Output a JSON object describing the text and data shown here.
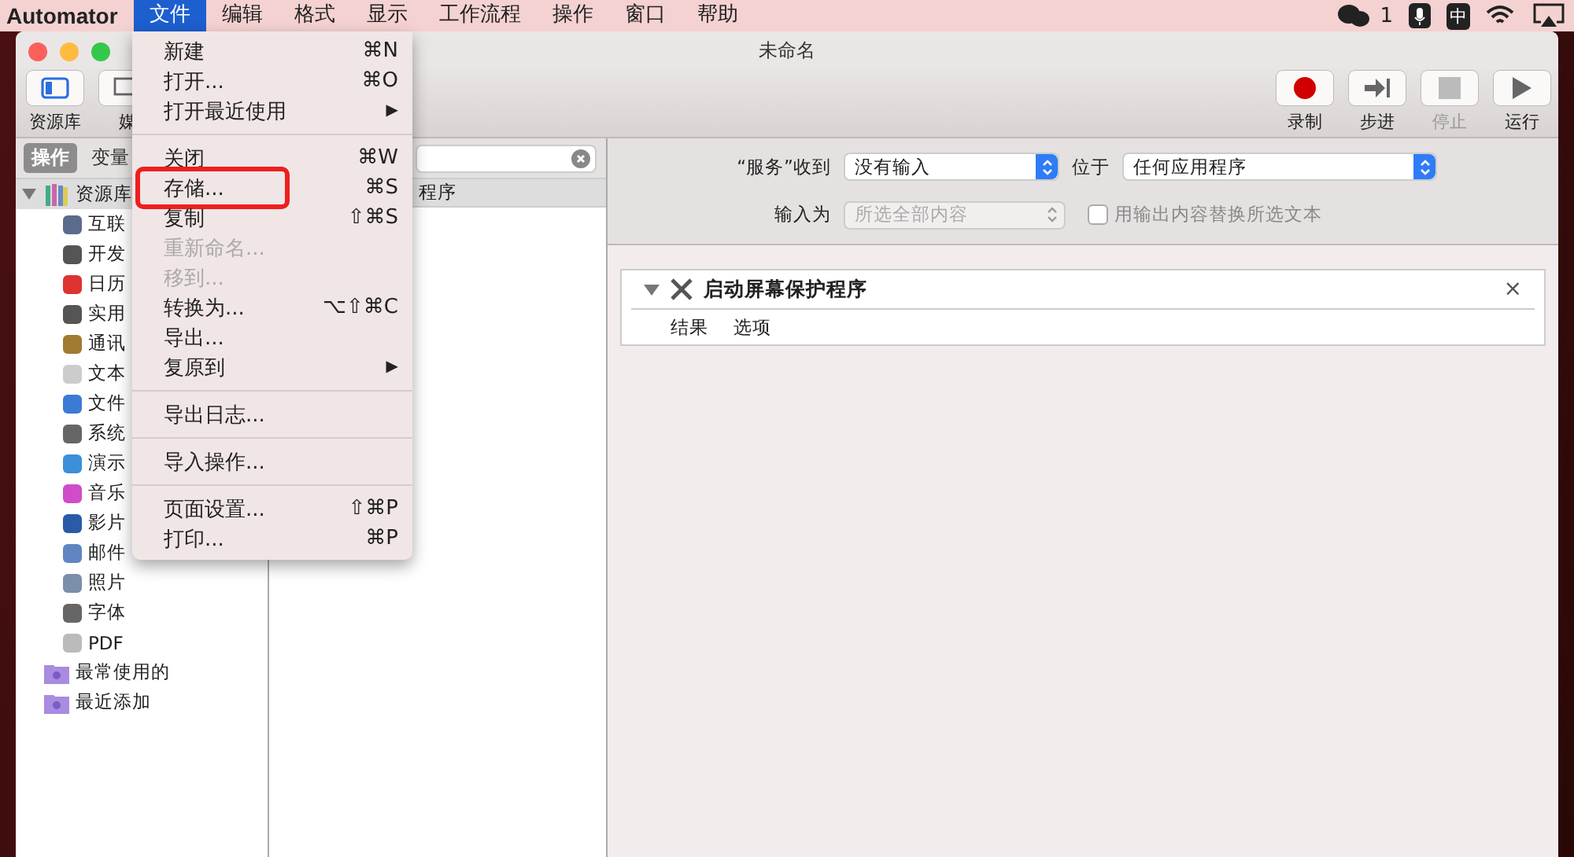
{
  "menubar": {
    "app": "Automator",
    "menus": [
      {
        "label": "文件",
        "selected": true
      },
      {
        "label": "编辑",
        "selected": false
      },
      {
        "label": "格式",
        "selected": false
      },
      {
        "label": "显示",
        "selected": false
      },
      {
        "label": "工作流程",
        "selected": false
      },
      {
        "label": "操作",
        "selected": false
      },
      {
        "label": "窗口",
        "selected": false
      },
      {
        "label": "帮助",
        "selected": false
      }
    ],
    "badge": "1",
    "input_method": "中"
  },
  "window": {
    "title": "未命名",
    "toolbar_left": [
      {
        "label": "资源库"
      },
      {
        "label": "媒"
      }
    ],
    "toolbar_right": [
      {
        "label": "录制",
        "kind": "record",
        "disabled": false
      },
      {
        "label": "步进",
        "kind": "step",
        "disabled": false
      },
      {
        "label": "停止",
        "kind": "stop",
        "disabled": true
      },
      {
        "label": "运行",
        "kind": "run",
        "disabled": false
      }
    ]
  },
  "library": {
    "tabs": [
      {
        "label": "操作",
        "selected": true
      },
      {
        "label": "变量",
        "selected": false
      }
    ],
    "tree": [
      {
        "label": "资源库",
        "expanded": true,
        "children": [
          {
            "label": "互联"
          },
          {
            "label": "开发"
          },
          {
            "label": "日历"
          },
          {
            "label": "实用"
          },
          {
            "label": "通讯"
          },
          {
            "label": "文本"
          },
          {
            "label": "文件"
          },
          {
            "label": "系统"
          },
          {
            "label": "演示"
          },
          {
            "label": "音乐"
          },
          {
            "label": "影片"
          },
          {
            "label": "邮件"
          },
          {
            "label": "照片"
          },
          {
            "label": "字体"
          },
          {
            "label": "PDF"
          }
        ]
      },
      {
        "label": "最常使用的"
      },
      {
        "label": "最近添加"
      }
    ]
  },
  "actions_header": "程序",
  "file_menu": [
    {
      "kind": "item",
      "label": "新建",
      "shortcut": "⌘N",
      "disabled": false,
      "annotated": false
    },
    {
      "kind": "item",
      "label": "打开...",
      "shortcut": "⌘O",
      "disabled": false,
      "annotated": false
    },
    {
      "kind": "submenu",
      "label": "打开最近使用",
      "arrow": "▶",
      "disabled": false,
      "annotated": false
    },
    {
      "kind": "separator"
    },
    {
      "kind": "item",
      "label": "关闭",
      "shortcut": "⌘W",
      "disabled": false,
      "annotated": false
    },
    {
      "kind": "item",
      "label": "存储...",
      "shortcut": "⌘S",
      "disabled": false,
      "annotated": true
    },
    {
      "kind": "item",
      "label": "复制",
      "shortcut": "⇧⌘S",
      "disabled": false,
      "annotated": false
    },
    {
      "kind": "item",
      "label": "重新命名...",
      "disabled": true,
      "annotated": false
    },
    {
      "kind": "item",
      "label": "移到...",
      "disabled": true,
      "annotated": false
    },
    {
      "kind": "item",
      "label": "转换为...",
      "shortcut": "⌥⇧⌘C",
      "disabled": false,
      "annotated": false
    },
    {
      "kind": "item",
      "label": "导出...",
      "disabled": false,
      "annotated": false
    },
    {
      "kind": "submenu",
      "label": "复原到",
      "arrow": "▶",
      "disabled": false,
      "annotated": false
    },
    {
      "kind": "separator"
    },
    {
      "kind": "item",
      "label": "导出日志...",
      "disabled": false,
      "annotated": false
    },
    {
      "kind": "separator"
    },
    {
      "kind": "item",
      "label": "导入操作...",
      "disabled": false,
      "annotated": false
    },
    {
      "kind": "separator"
    },
    {
      "kind": "item",
      "label": "页面设置...",
      "shortcut": "⇧⌘P",
      "disabled": false,
      "annotated": false
    },
    {
      "kind": "item",
      "label": "打印...",
      "shortcut": "⌘P",
      "disabled": false,
      "annotated": false
    }
  ],
  "service": {
    "receives_label": "“服务”收到",
    "receives_value": "没有输入",
    "location_label": "位于",
    "location_value": "任何应用程序",
    "input_label": "输入为",
    "input_value": "所选全部内容",
    "input_disabled": true,
    "replace": {
      "label": "用输出内容替换所选文本",
      "checked": false
    }
  },
  "action": {
    "title": "启动屏幕保护程序",
    "expanded": true,
    "close": "×",
    "tabs": [
      "结果",
      "选项"
    ]
  }
}
